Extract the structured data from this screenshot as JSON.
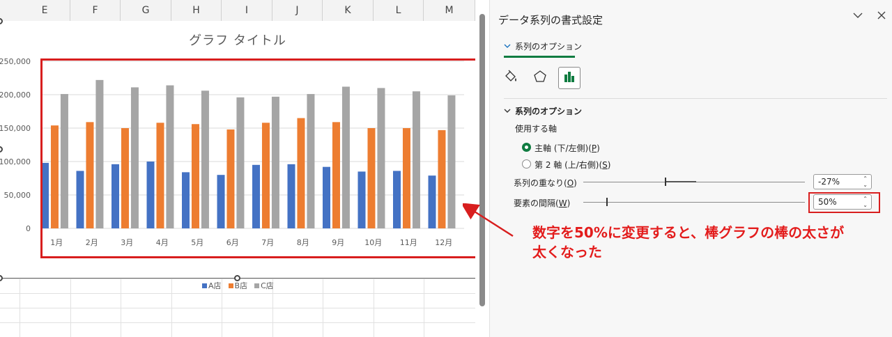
{
  "sheet": {
    "columns": [
      "E",
      "F",
      "G",
      "H",
      "I",
      "J",
      "K",
      "L",
      "M"
    ]
  },
  "chart": {
    "title": "グラフ タイトル"
  },
  "chart_data": {
    "type": "bar",
    "title": "グラフ タイトル",
    "categories": [
      "1月",
      "2月",
      "3月",
      "4月",
      "5月",
      "6月",
      "7月",
      "8月",
      "9月",
      "10月",
      "11月",
      "12月"
    ],
    "series": [
      {
        "name": "A店",
        "color": "#4472c4",
        "values": [
          98000,
          86000,
          96000,
          100000,
          84000,
          80000,
          95000,
          96000,
          92000,
          85000,
          86000,
          79000
        ]
      },
      {
        "name": "B店",
        "color": "#ed7d31",
        "values": [
          154000,
          159000,
          150000,
          158000,
          156000,
          148000,
          158000,
          165000,
          159000,
          150000,
          150000,
          147000
        ]
      },
      {
        "name": "C店",
        "color": "#a5a5a5",
        "values": [
          201000,
          222000,
          211000,
          214000,
          206000,
          196000,
          197000,
          201000,
          212000,
          210000,
          205000,
          199000
        ]
      }
    ],
    "yticks": [
      "250,000",
      "200,000",
      "150,000",
      "100,000",
      "50,000",
      "0"
    ],
    "ylim": [
      0,
      250000
    ],
    "grid": true,
    "legend": "bottom",
    "overlap_label": "-27%",
    "gap_width_label": "50%"
  },
  "panel": {
    "title": "データ系列の書式設定",
    "collapse_icon": "chevron-down-icon",
    "close_icon": "close-icon",
    "tab_label": "系列のオプション",
    "section_label": "系列のオプション",
    "axis_label": "使用する軸",
    "primary_axis": "主軸 (下/左側)(",
    "primary_axis_key": "P",
    "secondary_axis": "第 2 軸 (上/右側)(",
    "secondary_axis_key": "S",
    "overlap_label": "系列の重なり(",
    "overlap_key": "O",
    "overlap_value": "-27%",
    "gap_label": "要素の間隔(",
    "gap_key": "W",
    "gap_value": "50%"
  },
  "annotation": {
    "line1": "数字を50%に変更すると、棒グラフの棒の太さが",
    "line2": "太くなった",
    "color": "#e31c1c"
  }
}
